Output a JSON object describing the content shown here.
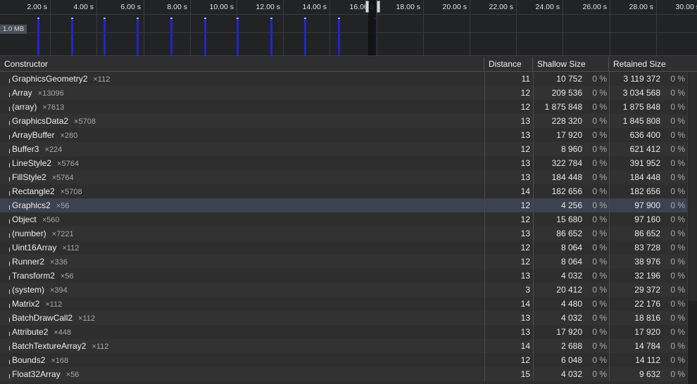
{
  "timeline": {
    "memory_label": "1.0 MB",
    "ticks": [
      "2.00 s",
      "4.00 s",
      "6.00 s",
      "8.00 s",
      "10.00 s",
      "12.00 s",
      "14.00 s",
      "16.00 s",
      "18.00 s",
      "20.00 s",
      "22.00 s",
      "24.00 s",
      "26.00 s",
      "28.00 s",
      "30.00 s"
    ],
    "bar_times_s": [
      1.45,
      2.9,
      4.3,
      5.7,
      7.15,
      8.6,
      10.0,
      11.45,
      12.9,
      14.35,
      15.9
    ],
    "selection_range_s": [
      15.55,
      15.95
    ],
    "colors": {
      "bar": "#2324c9",
      "selection": "#111111"
    }
  },
  "table": {
    "headers": {
      "constructor": "Constructor",
      "distance": "Distance",
      "shallow": "Shallow Size",
      "retained": "Retained Size"
    },
    "selected_row": "Graphics2",
    "rows": [
      {
        "name": "GraphicsGeometry2",
        "count": "×112",
        "distance": "11",
        "shallow": "10 752",
        "shallow_pct": "0 %",
        "retained": "3 119 372",
        "retained_pct": "0 %"
      },
      {
        "name": "Array",
        "count": "×13096",
        "distance": "12",
        "shallow": "209 536",
        "shallow_pct": "0 %",
        "retained": "3 034 568",
        "retained_pct": "0 %"
      },
      {
        "name": "(array)",
        "count": "×7613",
        "distance": "12",
        "shallow": "1 875 848",
        "shallow_pct": "0 %",
        "retained": "1 875 848",
        "retained_pct": "0 %"
      },
      {
        "name": "GraphicsData2",
        "count": "×5708",
        "distance": "13",
        "shallow": "228 320",
        "shallow_pct": "0 %",
        "retained": "1 845 808",
        "retained_pct": "0 %"
      },
      {
        "name": "ArrayBuffer",
        "count": "×280",
        "distance": "13",
        "shallow": "17 920",
        "shallow_pct": "0 %",
        "retained": "636 400",
        "retained_pct": "0 %"
      },
      {
        "name": "Buffer3",
        "count": "×224",
        "distance": "12",
        "shallow": "8 960",
        "shallow_pct": "0 %",
        "retained": "621 412",
        "retained_pct": "0 %"
      },
      {
        "name": "LineStyle2",
        "count": "×5764",
        "distance": "13",
        "shallow": "322 784",
        "shallow_pct": "0 %",
        "retained": "391 952",
        "retained_pct": "0 %"
      },
      {
        "name": "FillStyle2",
        "count": "×5764",
        "distance": "13",
        "shallow": "184 448",
        "shallow_pct": "0 %",
        "retained": "184 448",
        "retained_pct": "0 %"
      },
      {
        "name": "Rectangle2",
        "count": "×5708",
        "distance": "14",
        "shallow": "182 656",
        "shallow_pct": "0 %",
        "retained": "182 656",
        "retained_pct": "0 %"
      },
      {
        "name": "Graphics2",
        "count": "×56",
        "distance": "12",
        "shallow": "4 256",
        "shallow_pct": "0 %",
        "retained": "97 900",
        "retained_pct": "0 %"
      },
      {
        "name": "Object",
        "count": "×560",
        "distance": "12",
        "shallow": "15 680",
        "shallow_pct": "0 %",
        "retained": "97 160",
        "retained_pct": "0 %"
      },
      {
        "name": "(number)",
        "count": "×7221",
        "distance": "13",
        "shallow": "86 652",
        "shallow_pct": "0 %",
        "retained": "86 652",
        "retained_pct": "0 %"
      },
      {
        "name": "Uint16Array",
        "count": "×112",
        "distance": "12",
        "shallow": "8 064",
        "shallow_pct": "0 %",
        "retained": "83 728",
        "retained_pct": "0 %"
      },
      {
        "name": "Runner2",
        "count": "×336",
        "distance": "12",
        "shallow": "8 064",
        "shallow_pct": "0 %",
        "retained": "38 976",
        "retained_pct": "0 %"
      },
      {
        "name": "Transform2",
        "count": "×56",
        "distance": "13",
        "shallow": "4 032",
        "shallow_pct": "0 %",
        "retained": "32 196",
        "retained_pct": "0 %"
      },
      {
        "name": "(system)",
        "count": "×394",
        "distance": "3",
        "shallow": "20 412",
        "shallow_pct": "0 %",
        "retained": "29 372",
        "retained_pct": "0 %"
      },
      {
        "name": "Matrix2",
        "count": "×112",
        "distance": "14",
        "shallow": "4 480",
        "shallow_pct": "0 %",
        "retained": "22 176",
        "retained_pct": "0 %"
      },
      {
        "name": "BatchDrawCall2",
        "count": "×112",
        "distance": "13",
        "shallow": "4 032",
        "shallow_pct": "0 %",
        "retained": "18 816",
        "retained_pct": "0 %"
      },
      {
        "name": "Attribute2",
        "count": "×448",
        "distance": "13",
        "shallow": "17 920",
        "shallow_pct": "0 %",
        "retained": "17 920",
        "retained_pct": "0 %"
      },
      {
        "name": "BatchTextureArray2",
        "count": "×112",
        "distance": "14",
        "shallow": "2 688",
        "shallow_pct": "0 %",
        "retained": "14 784",
        "retained_pct": "0 %"
      },
      {
        "name": "Bounds2",
        "count": "×168",
        "distance": "12",
        "shallow": "6 048",
        "shallow_pct": "0 %",
        "retained": "14 112",
        "retained_pct": "0 %"
      },
      {
        "name": "Float32Array",
        "count": "×56",
        "distance": "15",
        "shallow": "4 032",
        "shallow_pct": "0 %",
        "retained": "9 632",
        "retained_pct": "0 %"
      }
    ]
  }
}
